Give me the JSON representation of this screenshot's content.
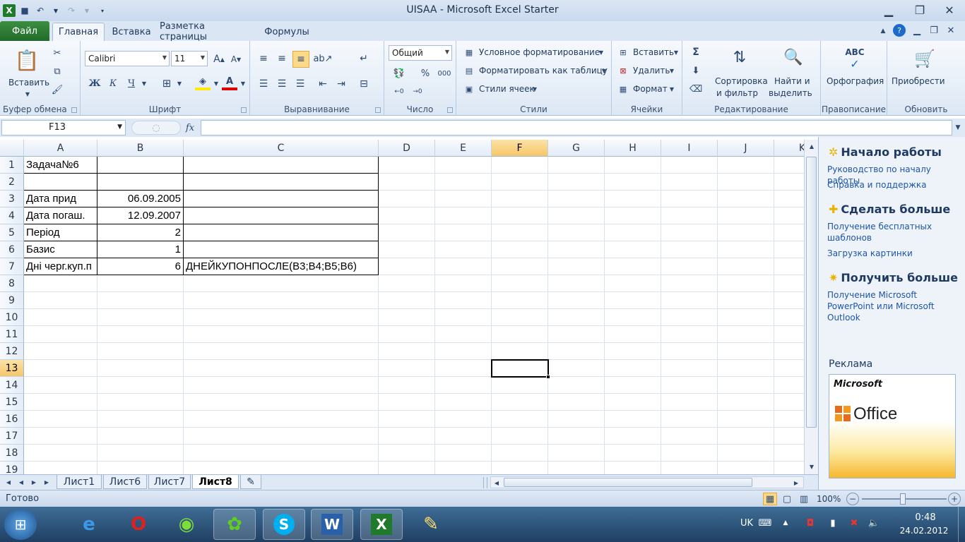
{
  "window": {
    "title": "UISAA - Microsoft Excel Starter"
  },
  "tabs": {
    "file": "Файл",
    "items": [
      "Главная",
      "Вставка",
      "Разметка страницы",
      "Формулы"
    ],
    "active_index": 0
  },
  "ribbon": {
    "clipboard": {
      "label": "Буфер обмена",
      "paste": "Вставить"
    },
    "font": {
      "label": "Шрифт",
      "name": "Calibri",
      "size": "11",
      "bold": "Ж",
      "italic": "К",
      "underline": "Ч"
    },
    "alignment": {
      "label": "Выравнивание"
    },
    "number": {
      "label": "Число",
      "format": "Общий",
      "percent": "%",
      "thousands": "000"
    },
    "styles": {
      "label": "Стили",
      "conditional": "Условное форматирование",
      "as_table": "Форматировать как таблицу",
      "cell_styles": "Стили ячеек"
    },
    "cells": {
      "label": "Ячейки",
      "insert": "Вставить",
      "delete": "Удалить",
      "format": "Формат"
    },
    "editing": {
      "label": "Редактирование",
      "sort_1": "Сортировка",
      "sort_2": "и фильтр",
      "find_1": "Найти и",
      "find_2": "выделить",
      "sum_icon": "Σ"
    },
    "proofing": {
      "label": "Правописание",
      "spelling": "Орфография",
      "abc": "ABC"
    },
    "update": {
      "label": "Обновить",
      "buy": "Приобрести"
    }
  },
  "formula_bar": {
    "name_box": "F13",
    "fx": "fx",
    "formula": ""
  },
  "columns": [
    "A",
    "B",
    "C",
    "D",
    "E",
    "F",
    "G",
    "H",
    "I",
    "J",
    "K"
  ],
  "rows": [
    "1",
    "2",
    "3",
    "4",
    "5",
    "6",
    "7",
    "8",
    "9",
    "10",
    "11",
    "12",
    "13",
    "14",
    "15",
    "16",
    "17",
    "18",
    "19"
  ],
  "selected": {
    "column": "F",
    "row": "13"
  },
  "cells": {
    "A1": "Задача№6",
    "A3": "Дата прид",
    "B3": "06.09.2005",
    "A4": "Дата погаш.",
    "B4": "12.09.2007",
    "A5": "Період",
    "B5": "2",
    "A6": "Базис",
    "B6": "1",
    "A7": "Дні черг.куп.п",
    "B7": "6",
    "C7": "ДНЕЙКУПОНПОСЛЕ(B3;B4;B5;B6)"
  },
  "sheet_tabs": [
    "Лист1",
    "Лист6",
    "Лист7",
    "Лист8"
  ],
  "active_sheet": "Лист8",
  "task_pane": {
    "start_title": "Начало работы",
    "start_links": [
      "Руководство по началу работы",
      "Справка и поддержка"
    ],
    "more_title": "Сделать больше",
    "more_links": [
      "Получение бесплатных шаблонов",
      "Загрузка картинки"
    ],
    "get_title": "Получить больше",
    "get_links": [
      "Получение Microsoft PowerPoint или Microsoft Outlook"
    ],
    "ad_label": "Реклама",
    "ad_brand": "Microsoft",
    "ad_product": "Office"
  },
  "status": {
    "ready": "Готово",
    "zoom": "100%"
  },
  "taskbar": {
    "lang": "UK",
    "time": "0:48",
    "date": "24.02.2012"
  },
  "colors": {
    "accent": "#226a2a",
    "selection": "#f6c667",
    "ribbon": "#dde8f5"
  }
}
